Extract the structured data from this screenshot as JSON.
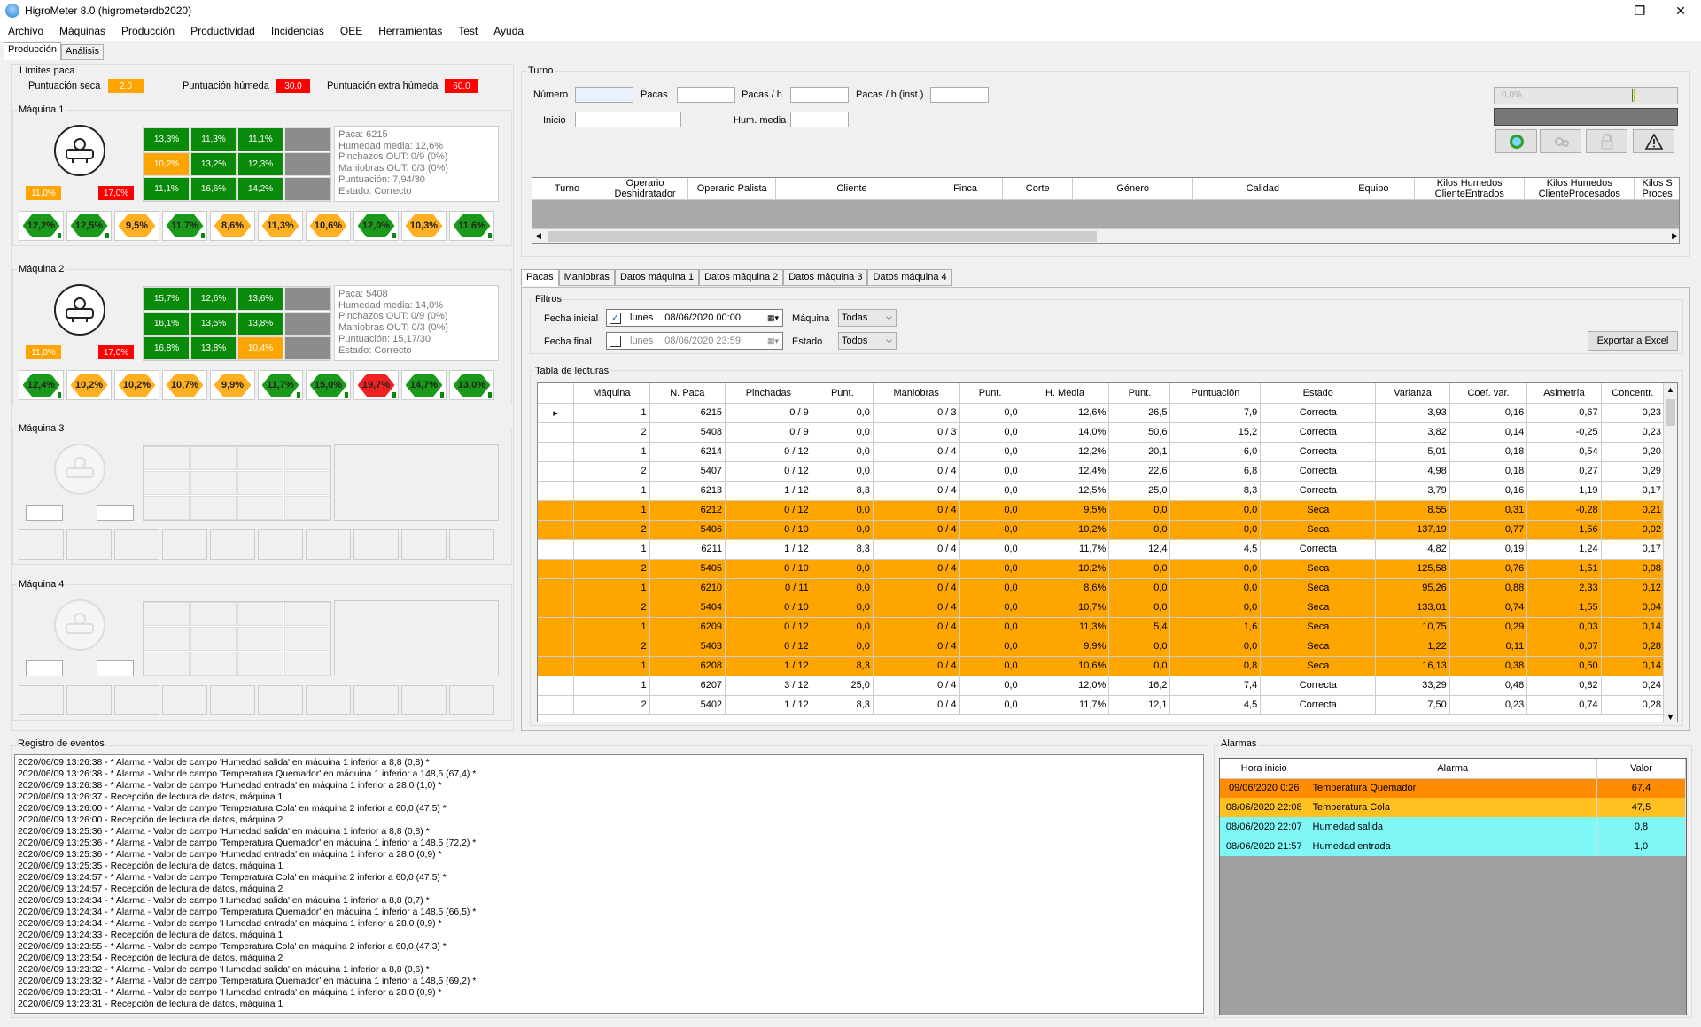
{
  "window": {
    "title": "HigroMeter 8.0 (higrometerdb2020)",
    "buttons": [
      "—",
      "❐",
      "✕"
    ]
  },
  "menu": [
    "Archivo",
    "Máquinas",
    "Producción",
    "Productividad",
    "Incidencias",
    "OEE",
    "Herramientas",
    "Test",
    "Ayuda"
  ],
  "main_tabs": [
    "Producción",
    "Análisis"
  ],
  "limits": {
    "title": "Límites paca",
    "seca_label": "Puntuación seca",
    "seca_value": "2,0",
    "humeda_label": "Puntuación húmeda",
    "humeda_value": "30,0",
    "extra_label": "Puntuación extra húmeda",
    "extra_value": "60,0"
  },
  "machines": [
    {
      "title": "Máquina 1",
      "min": "11,0%",
      "max": "17,0%",
      "grid": [
        [
          "13,3%",
          "11,3%",
          "11,1%",
          ""
        ],
        [
          "10,2%",
          "13,2%",
          "12,3%",
          ""
        ],
        [
          "11,1%",
          "16,6%",
          "14,2%",
          ""
        ]
      ],
      "info": [
        "Paca: 6215",
        "Humedad media: 12,6%",
        "Pinchazos OUT: 0/9 (0%)",
        "Maniobras OUT: 0/3 (0%)",
        "Puntuación: 7,94/30",
        "Estado: Correcto"
      ],
      "hex": [
        "12,2%",
        "12,5%",
        "9,5%",
        "11,7%",
        "8,6%",
        "11,3%",
        "10,6%",
        "12,0%",
        "10,3%",
        "11,6%"
      ]
    },
    {
      "title": "Máquina 2",
      "min": "11,0%",
      "max": "17,0%",
      "grid": [
        [
          "15,7%",
          "12,6%",
          "13,6%",
          ""
        ],
        [
          "16,1%",
          "13,5%",
          "13,8%",
          ""
        ],
        [
          "16,8%",
          "13,8%",
          "10,4%",
          ""
        ]
      ],
      "info": [
        "Paca: 5408",
        "Humedad media: 14,0%",
        "Pinchazos OUT: 0/9 (0%)",
        "Maniobras OUT: 0/3 (0%)",
        "Puntuación: 15,17/30",
        "Estado: Correcto"
      ],
      "hex": [
        "12,4%",
        "10,2%",
        "10,2%",
        "10,7%",
        "9,9%",
        "11,7%",
        "15,0%",
        "19,7%",
        "14,7%",
        "13,0%"
      ]
    },
    {
      "title": "Máquina 3"
    },
    {
      "title": "Máquina 4"
    }
  ],
  "turno": {
    "title": "Turno",
    "numero_label": "Número",
    "pacas_label": "Pacas",
    "pacash_label": "Pacas / h",
    "pacash_inst_label": "Pacas / h (inst.)",
    "inicio_label": "Inicio",
    "hum_media_label": "Hum. media",
    "progress_text": "0,0%",
    "columns": [
      "Turno",
      "Operario Deshidratador",
      "Operario Palista",
      "Cliente",
      "Finca",
      "Corte",
      "Género",
      "Calidad",
      "Equipo",
      "Kilos Humedos ClienteEntrados",
      "Kilos Humedos ClienteProcesados",
      "Kilos S Proces"
    ]
  },
  "sub_tabs": [
    "Pacas",
    "Maniobras",
    "Datos máquina 1",
    "Datos máquina 2",
    "Datos máquina 3",
    "Datos máquina 4"
  ],
  "filters": {
    "title": "Filtros",
    "fecha_inicial_label": "Fecha inicial",
    "fecha_inicial_day": "lunes",
    "fecha_inicial_value": "08/06/2020 00:00",
    "fecha_final_label": "Fecha final",
    "fecha_final_day": "lunes",
    "fecha_final_value": "08/06/2020 23:59",
    "maquina_label": "Máquina",
    "maquina_value": "Todas",
    "estado_label": "Estado",
    "estado_value": "Todos",
    "export_label": "Exportar a Excel"
  },
  "readings": {
    "title": "Tabla de lecturas",
    "columns": [
      "Máquina",
      "N. Paca",
      "Pinchadas",
      "Punt.",
      "Maniobras",
      "Punt.",
      "H. Media",
      "Punt.",
      "Puntuación",
      "Estado",
      "Varianza",
      "Coef. var.",
      "Asimetría",
      "Concentr."
    ],
    "rows": [
      [
        "1",
        "6215",
        "0 / 9",
        "0,0",
        "0 / 3",
        "0,0",
        "12,6%",
        "26,5",
        "7,9",
        "Correcta",
        "3,93",
        "0,16",
        "0,67",
        "0,23"
      ],
      [
        "2",
        "5408",
        "0 / 9",
        "0,0",
        "0 / 3",
        "0,0",
        "14,0%",
        "50,6",
        "15,2",
        "Correcta",
        "3,82",
        "0,14",
        "-0,25",
        "0,23"
      ],
      [
        "1",
        "6214",
        "0 / 12",
        "0,0",
        "0 / 4",
        "0,0",
        "12,2%",
        "20,1",
        "6,0",
        "Correcta",
        "5,01",
        "0,18",
        "0,54",
        "0,20"
      ],
      [
        "2",
        "5407",
        "0 / 12",
        "0,0",
        "0 / 4",
        "0,0",
        "12,4%",
        "22,6",
        "6,8",
        "Correcta",
        "4,98",
        "0,18",
        "0,27",
        "0,29"
      ],
      [
        "1",
        "6213",
        "1 / 12",
        "8,3",
        "0 / 4",
        "0,0",
        "12,5%",
        "25,0",
        "8,3",
        "Correcta",
        "3,79",
        "0,16",
        "1,19",
        "0,17"
      ],
      [
        "1",
        "6212",
        "0 / 12",
        "0,0",
        "0 / 4",
        "0,0",
        "9,5%",
        "0,0",
        "0,0",
        "Seca",
        "8,55",
        "0,31",
        "-0,28",
        "0,21"
      ],
      [
        "2",
        "5406",
        "0 / 10",
        "0,0",
        "0 / 4",
        "0,0",
        "10,2%",
        "0,0",
        "0,0",
        "Seca",
        "137,19",
        "0,77",
        "1,56",
        "0,02"
      ],
      [
        "1",
        "6211",
        "1 / 12",
        "8,3",
        "0 / 4",
        "0,0",
        "11,7%",
        "12,4",
        "4,5",
        "Correcta",
        "4,82",
        "0,19",
        "1,24",
        "0,17"
      ],
      [
        "2",
        "5405",
        "0 / 10",
        "0,0",
        "0 / 4",
        "0,0",
        "10,2%",
        "0,0",
        "0,0",
        "Seca",
        "125,58",
        "0,76",
        "1,51",
        "0,08"
      ],
      [
        "1",
        "6210",
        "0 / 11",
        "0,0",
        "0 / 4",
        "0,0",
        "8,6%",
        "0,0",
        "0,0",
        "Seca",
        "95,26",
        "0,88",
        "2,33",
        "0,12"
      ],
      [
        "2",
        "5404",
        "0 / 10",
        "0,0",
        "0 / 4",
        "0,0",
        "10,7%",
        "0,0",
        "0,0",
        "Seca",
        "133,01",
        "0,74",
        "1,55",
        "0,04"
      ],
      [
        "1",
        "6209",
        "0 / 12",
        "0,0",
        "0 / 4",
        "0,0",
        "11,3%",
        "5,4",
        "1,6",
        "Seca",
        "10,75",
        "0,29",
        "0,03",
        "0,14"
      ],
      [
        "2",
        "5403",
        "0 / 12",
        "0,0",
        "0 / 4",
        "0,0",
        "9,9%",
        "0,0",
        "0,0",
        "Seca",
        "1,22",
        "0,11",
        "0,07",
        "0,28"
      ],
      [
        "1",
        "6208",
        "1 / 12",
        "8,3",
        "0 / 4",
        "0,0",
        "10,6%",
        "0,0",
        "0,8",
        "Seca",
        "16,13",
        "0,38",
        "0,50",
        "0,14"
      ],
      [
        "1",
        "6207",
        "3 / 12",
        "25,0",
        "0 / 4",
        "0,0",
        "12,0%",
        "16,2",
        "7,4",
        "Correcta",
        "33,29",
        "0,48",
        "0,82",
        "0,24"
      ],
      [
        "2",
        "5402",
        "1 / 12",
        "8,3",
        "0 / 4",
        "0,0",
        "11,7%",
        "12,1",
        "4,5",
        "Correcta",
        "7,50",
        "0,23",
        "0,74",
        "0,28"
      ]
    ]
  },
  "events": {
    "title": "Registro de eventos",
    "lines": [
      "2020/06/09 13:26:38 - * Alarma - Valor de campo 'Humedad salida' en máquina 1 inferior a 8,8 (0,8) *",
      "2020/06/09 13:26:38 - * Alarma - Valor de campo 'Temperatura Quemador' en máquina 1 inferior a 148,5 (67,4) *",
      "2020/06/09 13:26:38 - * Alarma - Valor de campo 'Humedad entrada' en máquina 1 inferior a 28,0 (1,0) *",
      "2020/06/09 13:26:37 - Recepción de lectura de datos, máquina 1",
      "2020/06/09 13:26:00 - * Alarma - Valor de campo 'Temperatura Cola' en máquina 2 inferior a 60,0 (47,5) *",
      "2020/06/09 13:26:00 - Recepción de lectura de datos, máquina 2",
      "2020/06/09 13:25:36 - * Alarma - Valor de campo 'Humedad salida' en máquina 1 inferior a 8,8 (0,8) *",
      "2020/06/09 13:25:36 - * Alarma - Valor de campo 'Temperatura Quemador' en máquina 1 inferior a 148,5 (72,2) *",
      "2020/06/09 13:25:36 - * Alarma - Valor de campo 'Humedad entrada' en máquina 1 inferior a 28,0 (0,9) *",
      "2020/06/09 13:25:35 - Recepción de lectura de datos, máquina 1",
      "2020/06/09 13:24:57 - * Alarma - Valor de campo 'Temperatura Cola' en máquina 2 inferior a 60,0 (47,5) *",
      "2020/06/09 13:24:57 - Recepción de lectura de datos, máquina 2",
      "2020/06/09 13:24:34 - * Alarma - Valor de campo 'Humedad salida' en máquina 1 inferior a 8,8 (0,7) *",
      "2020/06/09 13:24:34 - * Alarma - Valor de campo 'Temperatura Quemador' en máquina 1 inferior a 148,5 (66,5) *",
      "2020/06/09 13:24:34 - * Alarma - Valor de campo 'Humedad entrada' en máquina 1 inferior a 28,0 (0,9) *",
      "2020/06/09 13:24:33 - Recepción de lectura de datos, máquina 1",
      "2020/06/09 13:23:55 - * Alarma - Valor de campo 'Temperatura Cola' en máquina 2 inferior a 60,0 (47,3) *",
      "2020/06/09 13:23:54 - Recepción de lectura de datos, máquina 2",
      "2020/06/09 13:23:32 - * Alarma - Valor de campo 'Humedad salida' en máquina 1 inferior a 8,8 (0,6) *",
      "2020/06/09 13:23:32 - * Alarma - Valor de campo 'Temperatura Quemador' en máquina 1 inferior a 148,5 (69,2) *",
      "2020/06/09 13:23:31 - * Alarma - Valor de campo 'Humedad entrada' en máquina 1 inferior a 28,0 (0,9) *",
      "2020/06/09 13:23:31 - Recepción de lectura de datos, máquina 1"
    ]
  },
  "alarms": {
    "title": "Alarmas",
    "columns": [
      "Hora inicio",
      "Alarma",
      "Valor"
    ],
    "rows": [
      {
        "hora": "09/06/2020 0:26",
        "alarma": "Temperatura Quemador",
        "valor": "67,4",
        "color": "#ff8c00"
      },
      {
        "hora": "08/06/2020 22:08",
        "alarma": "Temperatura Cola",
        "valor": "47,5",
        "color": "#ffc020"
      },
      {
        "hora": "08/06/2020 22:07",
        "alarma": "Humedad salida",
        "valor": "0,8",
        "color": "#7ff7f7"
      },
      {
        "hora": "08/06/2020 21:57",
        "alarma": "Humedad entrada",
        "valor": "1,0",
        "color": "#7ff7f7"
      }
    ]
  }
}
